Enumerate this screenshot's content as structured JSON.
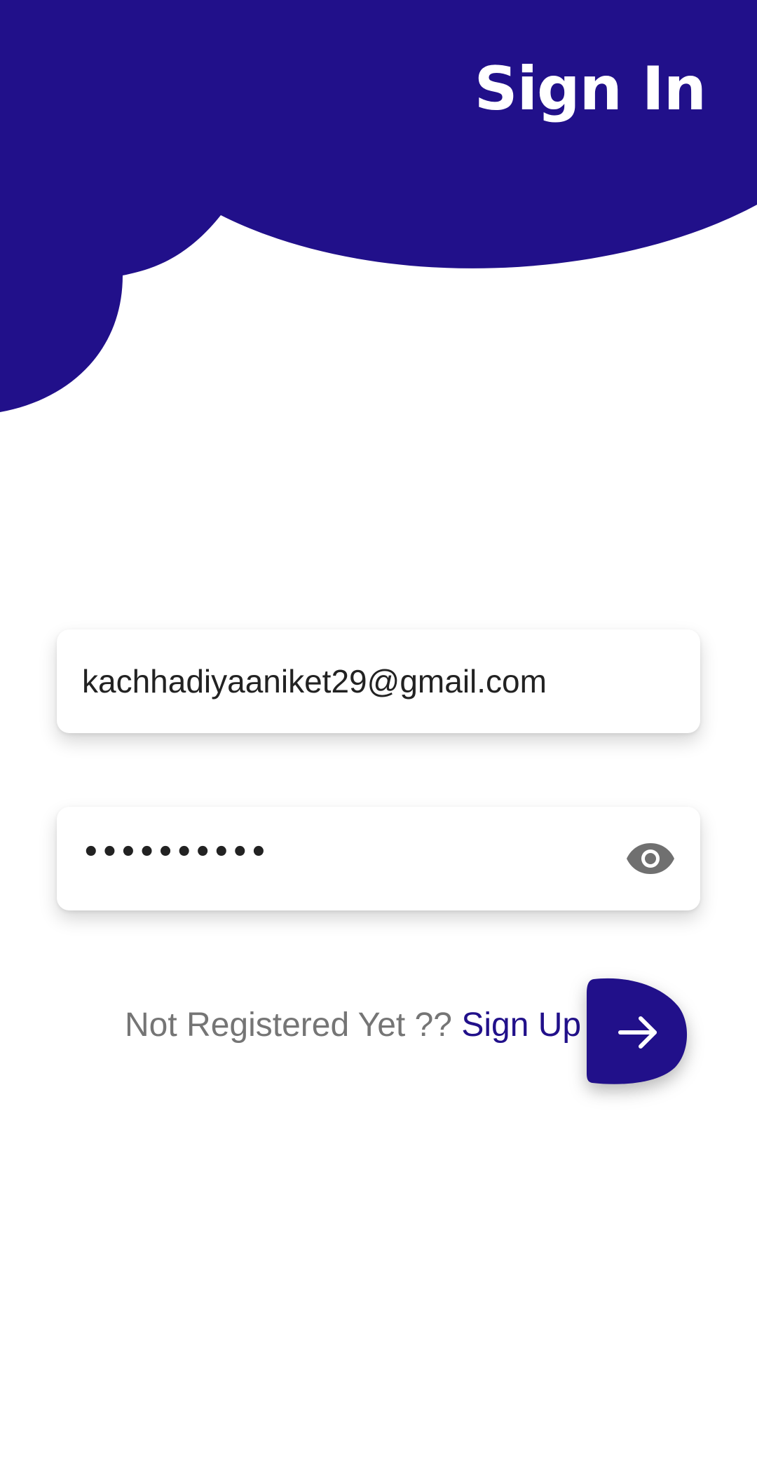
{
  "header": {
    "title": "Sign In"
  },
  "form": {
    "email": {
      "value": "kachhadiyaaniket29@gmail.com"
    },
    "password": {
      "masked_value": "••••••••••"
    }
  },
  "signup": {
    "prompt": "Not Registered Yet ?? ",
    "link_label": "Sign Up"
  },
  "icons": {
    "visibility": "eye-icon",
    "submit": "arrow-right-icon"
  },
  "colors": {
    "primary": "#21108a",
    "background": "#ffffff",
    "hint_text": "#757575",
    "icon_grey": "#707070"
  }
}
